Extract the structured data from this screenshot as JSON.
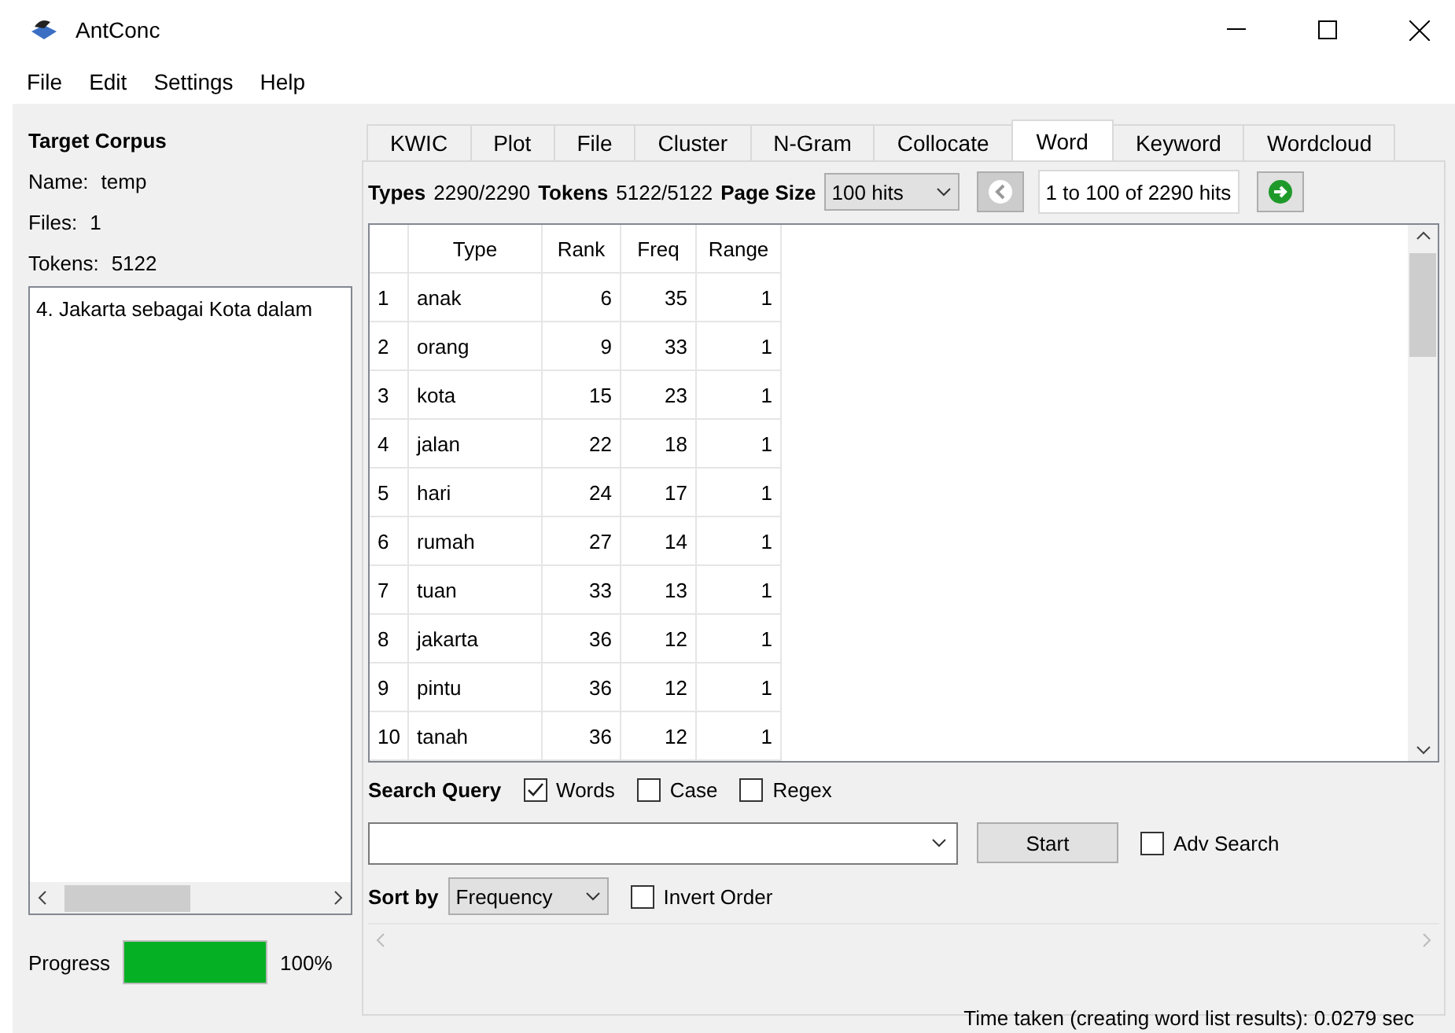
{
  "window": {
    "title": "AntConc"
  },
  "menu": [
    "File",
    "Edit",
    "Settings",
    "Help"
  ],
  "corpus": {
    "heading": "Target Corpus",
    "name_label": "Name:",
    "name": "temp",
    "files_label": "Files:",
    "files": "1",
    "tokens_label": "Tokens:",
    "tokens": "5122",
    "file_list": [
      "4. Jakarta sebagai Kota dalam"
    ]
  },
  "progress": {
    "label": "Progress",
    "level": 1,
    "reading": "100%"
  },
  "tabs": [
    {
      "label": "KWIC",
      "selected": false
    },
    {
      "label": "Plot",
      "selected": false
    },
    {
      "label": "File",
      "selected": false
    },
    {
      "label": "Cluster",
      "selected": false
    },
    {
      "label": "N-Gram",
      "selected": false
    },
    {
      "label": "Collocate",
      "selected": false
    },
    {
      "label": "Word",
      "selected": true
    },
    {
      "label": "Keyword",
      "selected": false
    },
    {
      "label": "Wordcloud",
      "selected": false
    }
  ],
  "stats": {
    "types_label": "Types",
    "types": "2290/2290",
    "tokens_label": "Tokens",
    "tokens": "5122/5122",
    "page_size_label": "Page Size",
    "page_size": "100 hits",
    "range": "1 to 100 of 2290 hits"
  },
  "table": {
    "columns": [
      "Type",
      "Rank",
      "Freq",
      "Range"
    ],
    "rows": [
      {
        "n": "1",
        "cells": [
          "anak",
          "6",
          "35",
          "1"
        ]
      },
      {
        "n": "2",
        "cells": [
          "orang",
          "9",
          "33",
          "1"
        ]
      },
      {
        "n": "3",
        "cells": [
          "kota",
          "15",
          "23",
          "1"
        ]
      },
      {
        "n": "4",
        "cells": [
          "jalan",
          "22",
          "18",
          "1"
        ]
      },
      {
        "n": "5",
        "cells": [
          "hari",
          "24",
          "17",
          "1"
        ]
      },
      {
        "n": "6",
        "cells": [
          "rumah",
          "27",
          "14",
          "1"
        ]
      },
      {
        "n": "7",
        "cells": [
          "tuan",
          "33",
          "13",
          "1"
        ]
      },
      {
        "n": "8",
        "cells": [
          "jakarta",
          "36",
          "12",
          "1"
        ]
      },
      {
        "n": "9",
        "cells": [
          "pintu",
          "36",
          "12",
          "1"
        ]
      },
      {
        "n": "10",
        "cells": [
          "tanah",
          "36",
          "12",
          "1"
        ]
      }
    ]
  },
  "search": {
    "label": "Search Query",
    "options": [
      {
        "label": "Words",
        "checked": true
      },
      {
        "label": "Case",
        "checked": false
      },
      {
        "label": "Regex",
        "checked": false
      }
    ],
    "start": "Start",
    "adv": {
      "label": "Adv Search",
      "checked": false
    }
  },
  "sort": {
    "label": "Sort by",
    "value": "Frequency",
    "invert": {
      "label": "Invert Order",
      "checked": false
    }
  },
  "status_bar": "Time taken (creating word list results):  0.0279 sec"
}
